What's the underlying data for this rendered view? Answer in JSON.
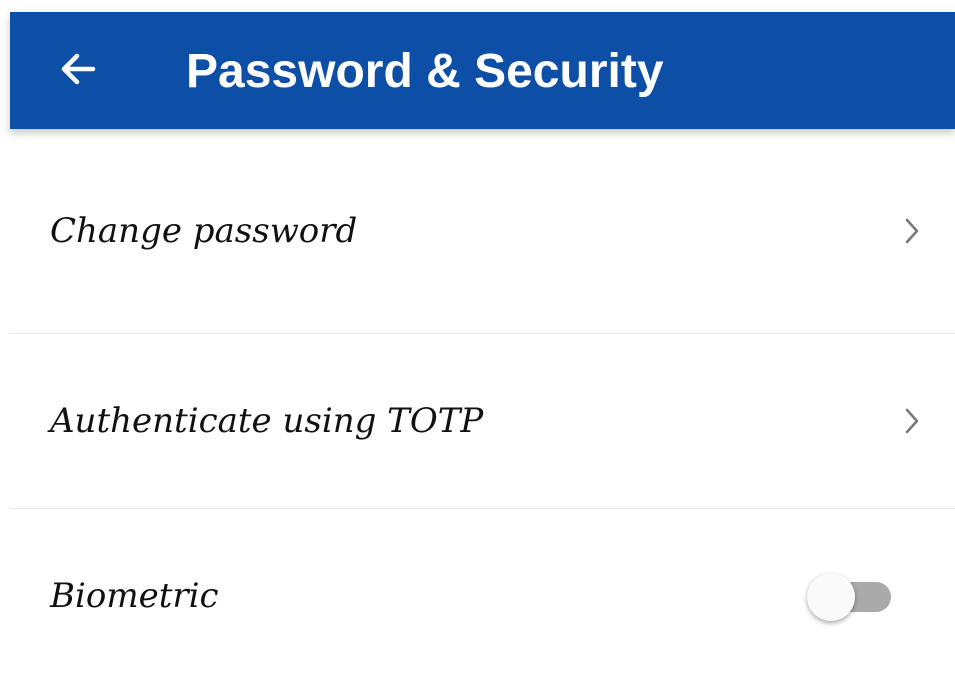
{
  "header": {
    "title": "Password & Security",
    "back_icon": "arrow-left-icon",
    "background_color": "#0d4ea6"
  },
  "settings": {
    "items": [
      {
        "label": "Change password",
        "type": "navigation",
        "icon": "chevron-right-icon"
      },
      {
        "label": "Authenticate using TOTP",
        "type": "navigation",
        "icon": "chevron-right-icon"
      },
      {
        "label": "Biometric",
        "type": "toggle",
        "enabled": false
      }
    ]
  },
  "colors": {
    "accent": "#0d4ea6",
    "text": "#111111",
    "toggle_track_off": "#aaaaaa",
    "chevron": "#777777"
  }
}
